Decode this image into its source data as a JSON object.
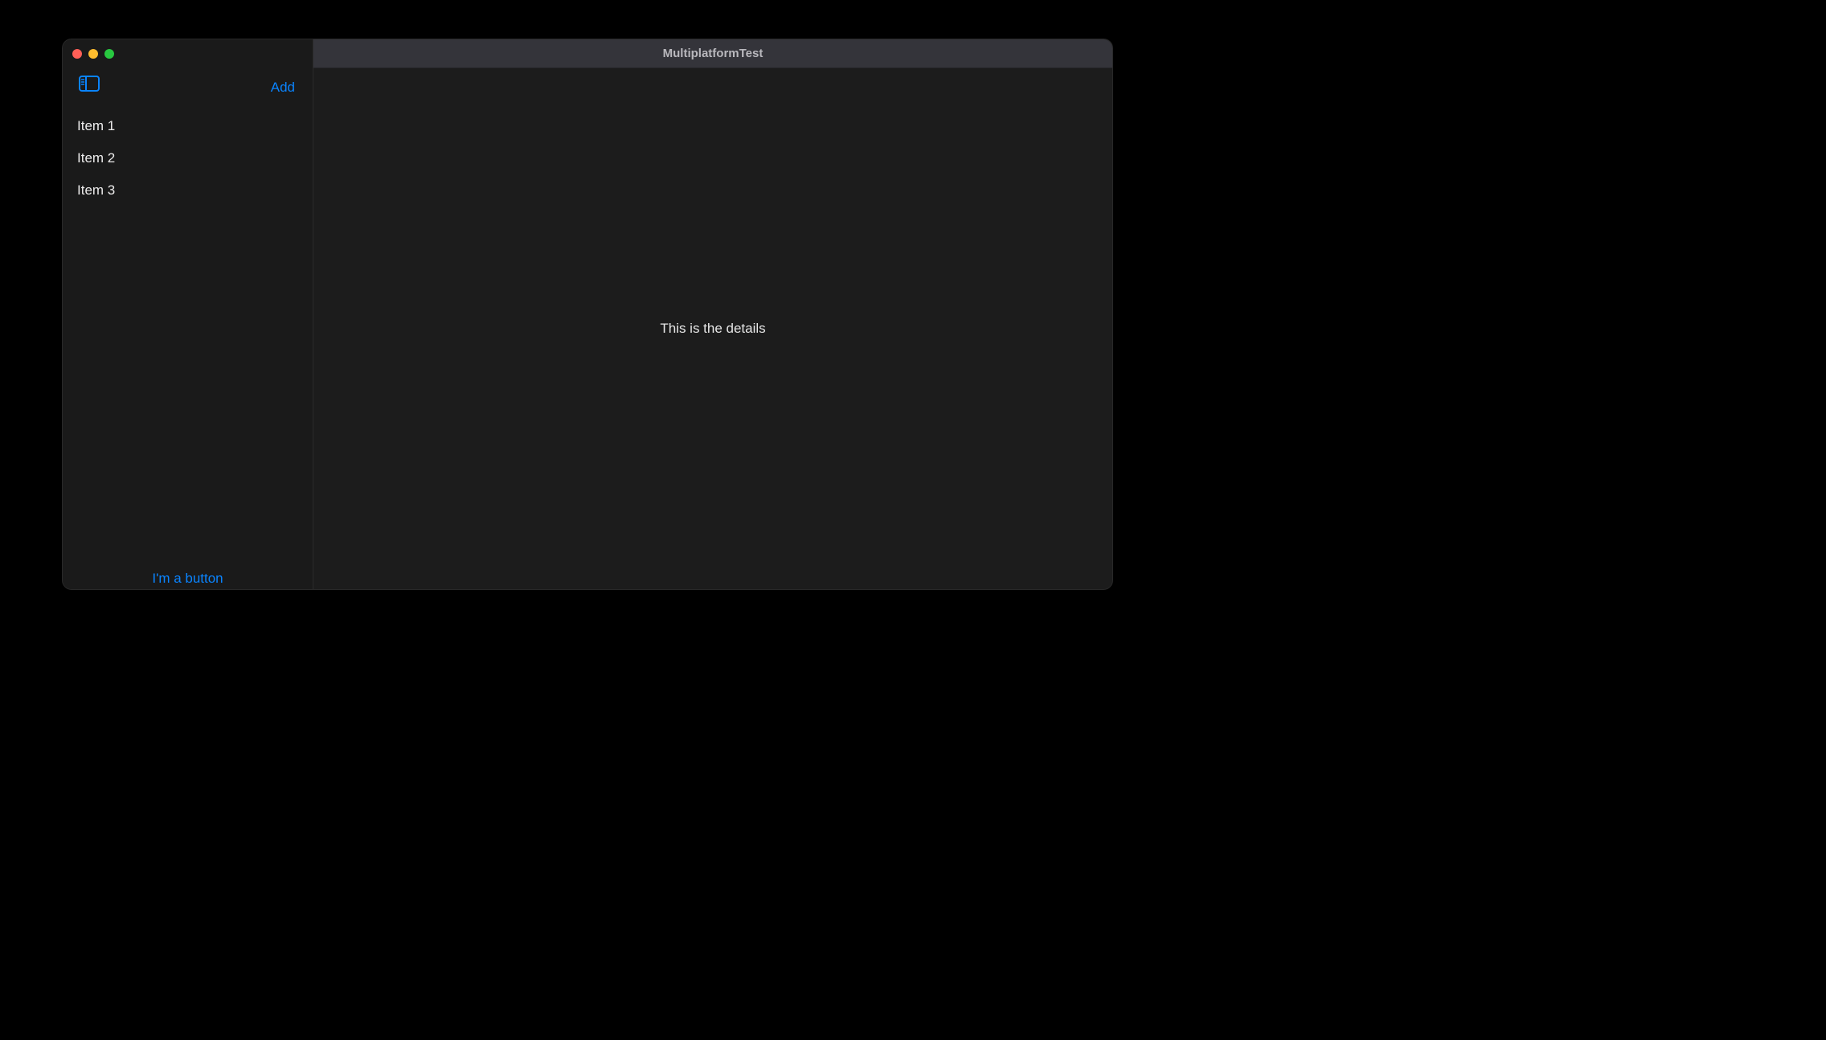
{
  "window": {
    "title": "MultiplatformTest"
  },
  "sidebar": {
    "toolbar": {
      "add_label": "Add"
    },
    "items": [
      {
        "label": "Item 1"
      },
      {
        "label": "Item 2"
      },
      {
        "label": "Item 3"
      }
    ],
    "footer": {
      "button_label": "I'm a button"
    }
  },
  "detail": {
    "text": "This is the details"
  },
  "colors": {
    "accent": "#0a84ff",
    "background": "#1c1c1c",
    "sidebar_background": "#1a1a1a",
    "titlebar_background": "#34343a"
  }
}
